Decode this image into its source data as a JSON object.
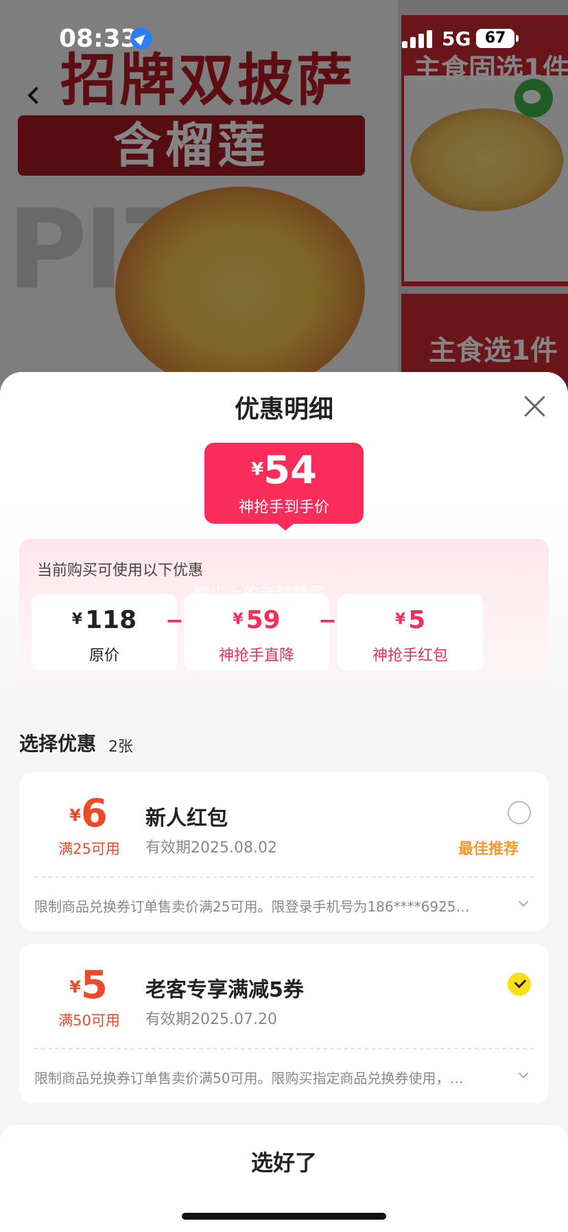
{
  "status_bar": {
    "time": "08:33",
    "network": "5G",
    "battery": "67"
  },
  "background": {
    "title_line1": "招牌双披萨",
    "title_line2": "含榴莲",
    "pizza_text": "PIZZ",
    "right_top_text": "主食固选1件",
    "right_bottom_text": "主食选1件"
  },
  "sheet": {
    "title": "优惠明细",
    "final_price": {
      "currency": "¥",
      "value": "54",
      "label": "神抢手到手价"
    },
    "calc": {
      "label": "当前购买可使用以下优惠",
      "watermark": "脚尖上的老饕馥菜",
      "items": [
        {
          "currency": "¥",
          "value": "118",
          "label": "原价",
          "color": "#222222"
        },
        {
          "currency": "¥",
          "value": "59",
          "label": "神抢手直降",
          "color": "#fa2d5a"
        },
        {
          "currency": "¥",
          "value": "5",
          "label": "神抢手红包",
          "color": "#fa2d5a"
        }
      ],
      "operator": "−"
    },
    "section": {
      "title": "选择优惠",
      "count": "2张"
    },
    "coupons": [
      {
        "currency": "¥",
        "amount": "6",
        "condition": "满25可用",
        "name": "新人红包",
        "valid": "有效期2025.08.02",
        "selected": false,
        "tag": "最佳推荐",
        "desc": "限制商品兑换券订单售卖价满25可用。限登录手机号为186****6925…"
      },
      {
        "currency": "¥",
        "amount": "5",
        "condition": "满50可用",
        "name": "老客专享满减5券",
        "valid": "有效期2025.07.20",
        "selected": true,
        "tag": "",
        "desc": "限制商品兑换券订单售卖价满50可用。限购买指定商品兑换券使用，…"
      }
    ],
    "confirm_label": "选好了"
  },
  "colors": {
    "accent": "#fa2d5a",
    "coupon": "#ee4a2a",
    "recommend": "#f39a2b",
    "check": "#ffdf1a"
  }
}
